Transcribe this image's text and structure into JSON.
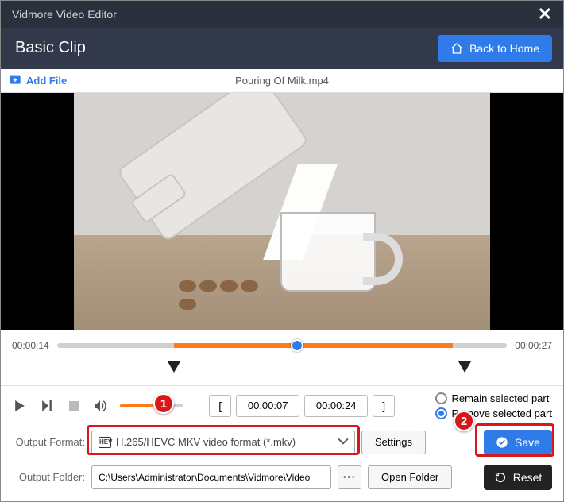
{
  "app_title": "Vidmore Video Editor",
  "section_title": "Basic Clip",
  "back_home": "Back to Home",
  "add_file": "Add File",
  "filename": "Pouring Of Milk.mp4",
  "timeline": {
    "start": "00:00:14",
    "end": "00:00:27"
  },
  "range": {
    "in": "00:00:07",
    "out": "00:00:24"
  },
  "selection_mode": {
    "remain": "Remain selected part",
    "remove": "Remove selected part"
  },
  "output": {
    "format_label": "Output Format:",
    "format_value": "H.265/HEVC MKV video format (*.mkv)",
    "format_icon": "HEV",
    "settings": "Settings",
    "folder_label": "Output Folder:",
    "folder_value": "C:\\Users\\Administrator\\Documents\\Vidmore\\Video",
    "open_folder": "Open Folder"
  },
  "save": "Save",
  "reset": "Reset",
  "callouts": {
    "one": "1",
    "two": "2"
  }
}
